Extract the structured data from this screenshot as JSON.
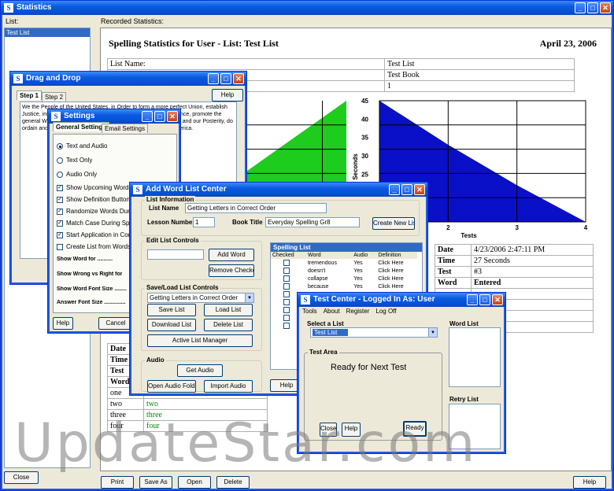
{
  "main": {
    "title": "Statistics",
    "list_label": "List:",
    "recorded_label": "Recorded Statistics:",
    "list_items": [
      "Test List"
    ],
    "close": "Close",
    "print": "Print",
    "save_as": "Save As",
    "open": "Open",
    "delete": "Delete",
    "help": "Help"
  },
  "report": {
    "heading": "Spelling Statistics for User - List: Test List",
    "date": "April 23, 2006",
    "info_rows": [
      {
        "k": "List Name:",
        "v": "Test List"
      },
      {
        "k": "",
        "v": "Test Book"
      },
      {
        "k": "",
        "v": "1"
      }
    ],
    "chart_y_label": "Seconds",
    "chart_x_label": "Tests",
    "chart_data": {
      "type": "area",
      "xlabel": "Tests",
      "ylabel": "Seconds",
      "ylim": [
        0,
        45
      ],
      "yticks": [
        15,
        20,
        25,
        30,
        35,
        40,
        45
      ],
      "xticks": [
        2,
        3,
        4
      ],
      "series": [
        {
          "color": "#1ECC1E",
          "x": [
            1,
            2,
            3,
            4
          ],
          "values": [
            25,
            37,
            45,
            45
          ]
        },
        {
          "color": "#0A10C8",
          "x": [
            1,
            2,
            3,
            4
          ],
          "values": [
            45,
            33,
            22,
            12
          ]
        }
      ]
    },
    "detail_rows": [
      {
        "k": "Date",
        "v": "4/23/2006 2:47:11 PM"
      },
      {
        "k": "Time",
        "v": "27 Seconds"
      },
      {
        "k": "Test",
        "v": "#3"
      },
      {
        "k": "Word",
        "v": "Entered"
      }
    ],
    "left_rows": [
      "Date",
      "Time",
      "Test",
      "Word"
    ],
    "words": [
      {
        "w": "one",
        "e": ""
      },
      {
        "w": "two",
        "e": "two"
      },
      {
        "w": "three",
        "e": "three"
      },
      {
        "w": "four",
        "e": "four"
      }
    ]
  },
  "drag": {
    "title": "Drag and Drop",
    "tab1": "Step 1",
    "tab2": "Step 2",
    "help": "Help",
    "text": "We the People of the United States, in Order to form a more perfect Union, establish Justice, insure domestic Tranquility, provide for the common defence, promote the general Welfare, and secure the Blessings of Liberty to ourselves and our Posterity, do ordain and establish this Constitution for the United States of America."
  },
  "settings": {
    "title": "Settings",
    "tab_general": "General Settings",
    "tab_email": "Email Settings",
    "radios": [
      {
        "label": "Text and Audio",
        "on": true
      },
      {
        "label": "Text Only",
        "on": false
      },
      {
        "label": "Audio Only",
        "on": false
      }
    ],
    "checks": [
      {
        "label": "Show Upcoming Words D",
        "on": true
      },
      {
        "label": "Show Definition Button D",
        "on": true
      },
      {
        "label": "Randomize Words During",
        "on": true
      },
      {
        "label": "Match Case During Spell",
        "on": true
      },
      {
        "label": "Start Application in Comp",
        "on": true
      },
      {
        "label": "Create List from Words S",
        "on": false
      }
    ],
    "fields": [
      "Show Word for ..........",
      "Show Wrong vs Right for",
      "Show Word Font Size ........",
      "Answer Font Size .............."
    ],
    "help": "Help",
    "cancel": "Cancel"
  },
  "addlist": {
    "title": "Add Word List Center",
    "info_group": "List Information",
    "list_name_label": "List Name",
    "list_name": "Getting Letters in Correct Order",
    "lesson_label": "Lesson Number",
    "lesson": "1",
    "book_label": "Book Title",
    "book": "Everyday Spelling Gr8",
    "create_new": "Create New List",
    "edit_group": "Edit List Controls",
    "add_word": "Add Word",
    "remove_checked": "Remove Checked",
    "saveload_group": "Save/Load List Controls",
    "selected_list": "Getting Letters in Correct Order",
    "save_list": "Save List",
    "load_list": "Load List",
    "download_list": "Download List",
    "delete_list": "Delete List",
    "active_manager": "Active List Manager",
    "audio_group": "Audio",
    "get_audio": "Get Audio",
    "open_audio_folder": "Open Audio Folder",
    "import_audio": "Import Audio",
    "spelling_list_title": "Spelling List",
    "cols": [
      "Checked",
      "Word",
      "Audio",
      "Definition"
    ],
    "rows": [
      {
        "w": "tremendous",
        "a": "Yes",
        "d": "Click Here"
      },
      {
        "w": "doesn't",
        "a": "Yes",
        "d": "Click Here"
      },
      {
        "w": "collapse",
        "a": "Yes",
        "d": "Click Here"
      },
      {
        "w": "because",
        "a": "Yes",
        "d": "Click Here"
      }
    ],
    "help": "Help"
  },
  "testcenter": {
    "title": "Test Center - Logged In As: User",
    "menu": [
      "Tools",
      "About",
      "Register",
      "Log Off"
    ],
    "select_label": "Select a List",
    "selected": "Test List",
    "test_area": "Test Area",
    "ready": "Ready for Next Test",
    "word_list": "Word List",
    "retry_list": "Retry List",
    "close": "Close",
    "help": "Help",
    "ready_btn": "Ready"
  },
  "watermark": "UpdateStar.com"
}
